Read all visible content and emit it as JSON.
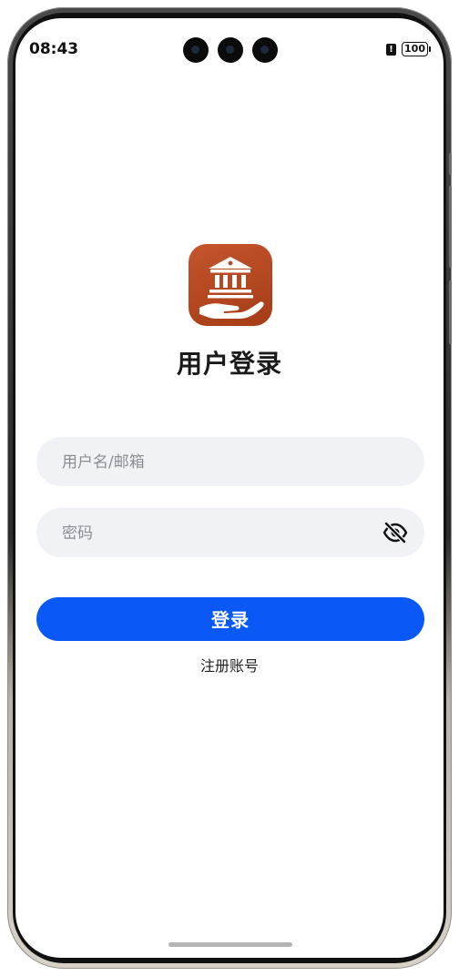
{
  "status_bar": {
    "time": "08:43",
    "battery": "100",
    "alert_icon": "alert-icon"
  },
  "app": {
    "logo_icon": "bank-hand-icon",
    "title": "用户登录"
  },
  "form": {
    "username_placeholder": "用户名/邮箱",
    "username_value": "",
    "password_placeholder": "密码",
    "password_value": "",
    "eye_icon": "eye-off-icon",
    "login_label": "登录",
    "register_label": "注册账号"
  },
  "colors": {
    "primary": "#0a59f7",
    "logo": "#b8482a",
    "field_bg": "#f1f2f6"
  }
}
